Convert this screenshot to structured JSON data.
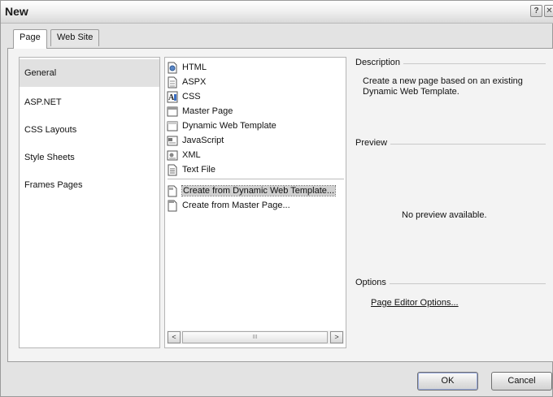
{
  "window": {
    "title": "New",
    "help_glyph": "?",
    "close_glyph": "✕"
  },
  "tabs": [
    {
      "label": "Page",
      "selected": true
    },
    {
      "label": "Web Site",
      "selected": false
    }
  ],
  "categories": [
    {
      "label": "General",
      "selected": true
    },
    {
      "label": "ASP.NET",
      "selected": false
    },
    {
      "label": "CSS Layouts",
      "selected": false
    },
    {
      "label": "Style Sheets",
      "selected": false
    },
    {
      "label": "Frames Pages",
      "selected": false
    }
  ],
  "page_types": [
    {
      "label": "HTML",
      "icon": "html-page-icon"
    },
    {
      "label": "ASPX",
      "icon": "aspx-page-icon"
    },
    {
      "label": "CSS",
      "icon": "css-file-icon"
    },
    {
      "label": "Master Page",
      "icon": "master-page-icon"
    },
    {
      "label": "Dynamic Web Template",
      "icon": "dwt-file-icon"
    },
    {
      "label": "JavaScript",
      "icon": "javascript-file-icon"
    },
    {
      "label": "XML",
      "icon": "xml-file-icon"
    },
    {
      "label": "Text File",
      "icon": "text-file-icon"
    }
  ],
  "page_actions": [
    {
      "label": "Create from Dynamic Web Template...",
      "icon": "dwt-create-icon",
      "selected": true
    },
    {
      "label": "Create from Master Page...",
      "icon": "master-create-icon",
      "selected": false
    }
  ],
  "scrollbar": {
    "left_glyph": "<",
    "right_glyph": ">",
    "thumb_grip": "III"
  },
  "description": {
    "heading": "Description",
    "text": "Create a new page based on an existing Dynamic Web Template."
  },
  "preview": {
    "heading": "Preview",
    "text": "No preview available."
  },
  "options": {
    "heading": "Options",
    "link": "Page Editor Options..."
  },
  "buttons": {
    "ok": "OK",
    "cancel": "Cancel"
  }
}
